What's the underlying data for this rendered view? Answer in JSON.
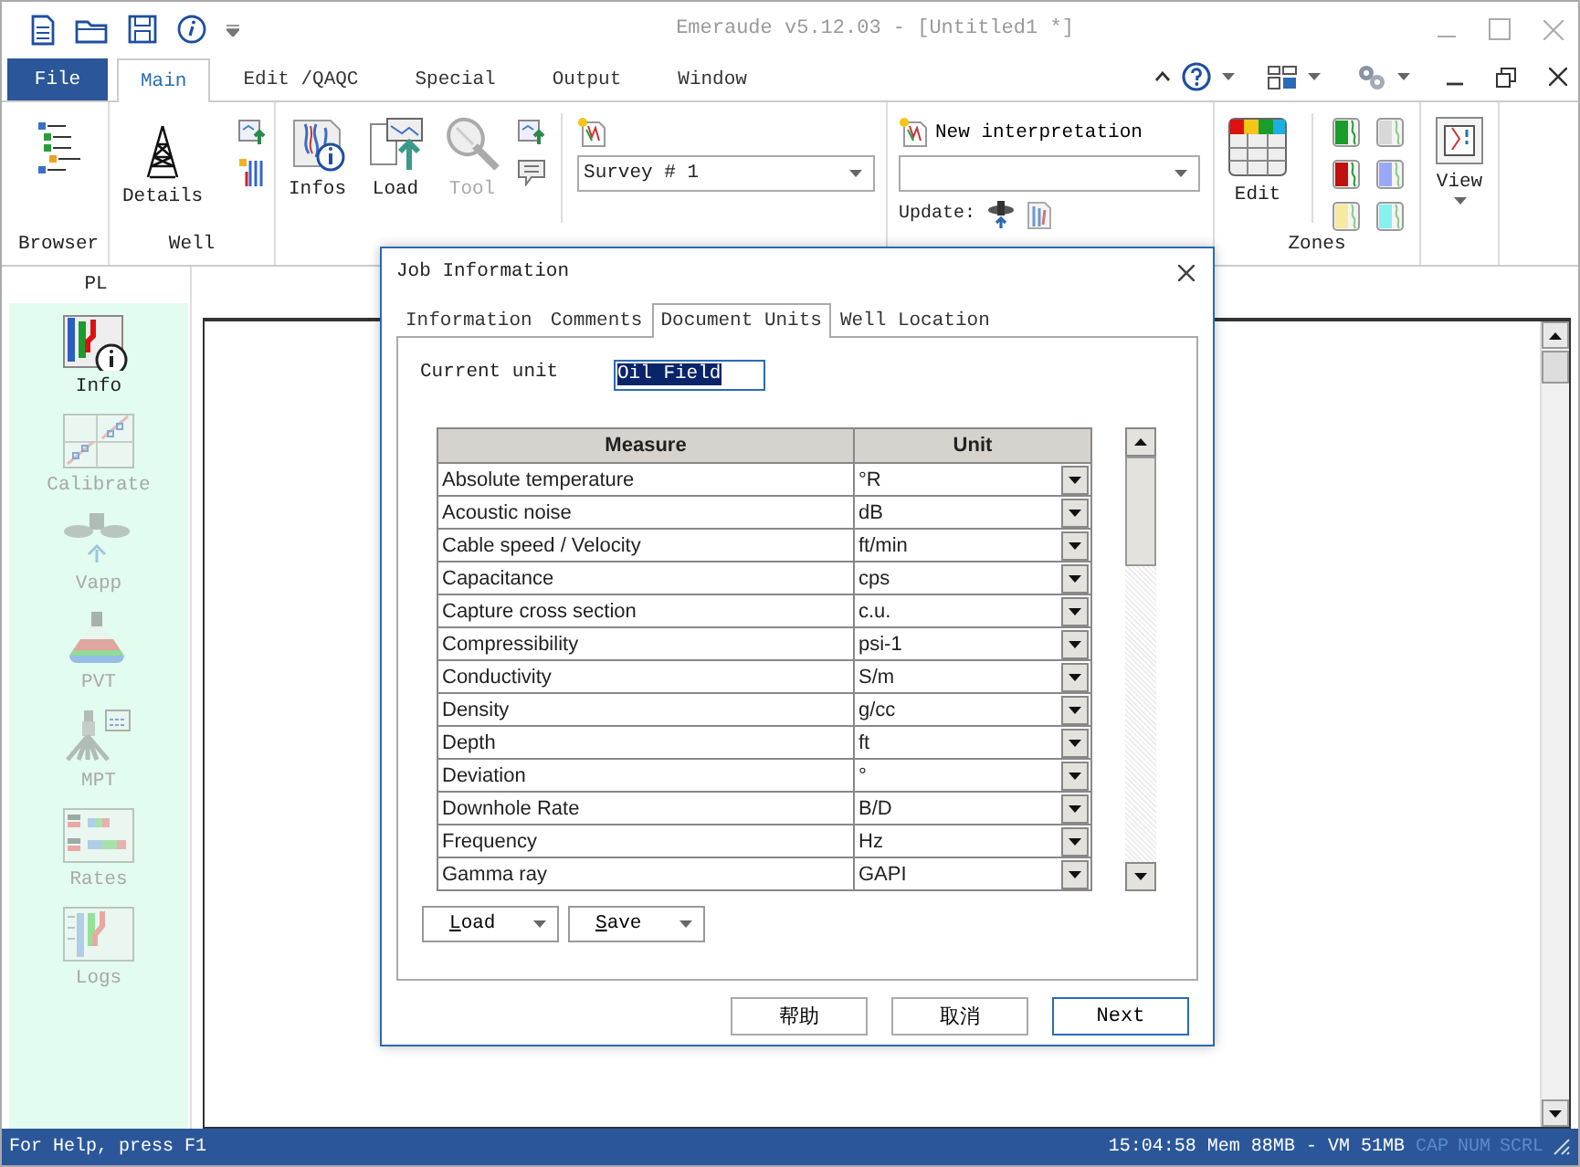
{
  "title_bar": {
    "title": "Emeraude  v5.12.03 - [Untitled1 *]"
  },
  "ribbon_tabs": [
    {
      "label": "File",
      "kind": "file",
      "selected": false
    },
    {
      "label": "Main",
      "kind": "tab",
      "selected": true
    },
    {
      "label": "Edit /QAQC",
      "kind": "tab",
      "selected": false
    },
    {
      "label": "Special",
      "kind": "tab",
      "selected": false
    },
    {
      "label": "Output",
      "kind": "tab",
      "selected": false
    },
    {
      "label": "Window",
      "kind": "tab",
      "selected": false
    }
  ],
  "ribbon": {
    "browser": {
      "label": "Browser"
    },
    "well": {
      "label": "Well",
      "details": "Details"
    },
    "survey": {
      "buttons": [
        {
          "label": "Infos",
          "disabled": false
        },
        {
          "label": "Load",
          "disabled": false
        },
        {
          "label": "Tool",
          "disabled": true
        }
      ],
      "survey_select": "Survey # 1"
    },
    "interpretation": {
      "new": "New interpretation",
      "update_label": "Update:"
    },
    "zones": {
      "label": "Zones",
      "edit": "Edit"
    },
    "view": {
      "label": "View"
    }
  },
  "sidebar": {
    "header": "PL",
    "items": [
      {
        "label": "Info",
        "disabled": false
      },
      {
        "label": "Calibrate",
        "disabled": true
      },
      {
        "label": "Vapp",
        "disabled": true
      },
      {
        "label": "PVT",
        "disabled": true
      },
      {
        "label": "MPT",
        "disabled": true
      },
      {
        "label": "Rates",
        "disabled": true
      },
      {
        "label": "Logs",
        "disabled": true
      }
    ]
  },
  "dialog": {
    "title": "Job Information",
    "tabs": [
      {
        "label": "Information",
        "selected": false
      },
      {
        "label": "Comments",
        "selected": false
      },
      {
        "label": "Document Units",
        "selected": true
      },
      {
        "label": "Well Location",
        "selected": false
      }
    ],
    "current_unit_label": "Current unit",
    "current_unit": "Oil Field",
    "table": {
      "columns": [
        "Measure",
        "Unit"
      ],
      "rows": [
        {
          "measure": "Absolute temperature",
          "unit": "°R"
        },
        {
          "measure": "Acoustic noise",
          "unit": "dB"
        },
        {
          "measure": "Cable speed / Velocity",
          "unit": "ft/min"
        },
        {
          "measure": "Capacitance",
          "unit": "cps"
        },
        {
          "measure": "Capture cross section",
          "unit": "c.u."
        },
        {
          "measure": "Compressibility",
          "unit": "psi-1"
        },
        {
          "measure": "Conductivity",
          "unit": "S/m"
        },
        {
          "measure": "Density",
          "unit": "g/cc"
        },
        {
          "measure": "Depth",
          "unit": "ft"
        },
        {
          "measure": "Deviation",
          "unit": "°"
        },
        {
          "measure": "Downhole Rate",
          "unit": "B/D"
        },
        {
          "measure": "Frequency",
          "unit": "Hz"
        },
        {
          "measure": "Gamma ray",
          "unit": "GAPI"
        }
      ]
    },
    "load": "Load",
    "save": "Save",
    "buttons": [
      {
        "label": "帮助",
        "kind": "plain"
      },
      {
        "label": "取消",
        "kind": "plain"
      },
      {
        "label": "Next",
        "kind": "default"
      }
    ]
  },
  "status_bar": {
    "help": "For Help, press F1",
    "info": "15:04:58 Mem 88MB - VM 51MB",
    "indicators": [
      {
        "label": "CAP",
        "on": false
      },
      {
        "label": "NUM",
        "on": false
      },
      {
        "label": "SCRL",
        "on": false
      }
    ]
  }
}
